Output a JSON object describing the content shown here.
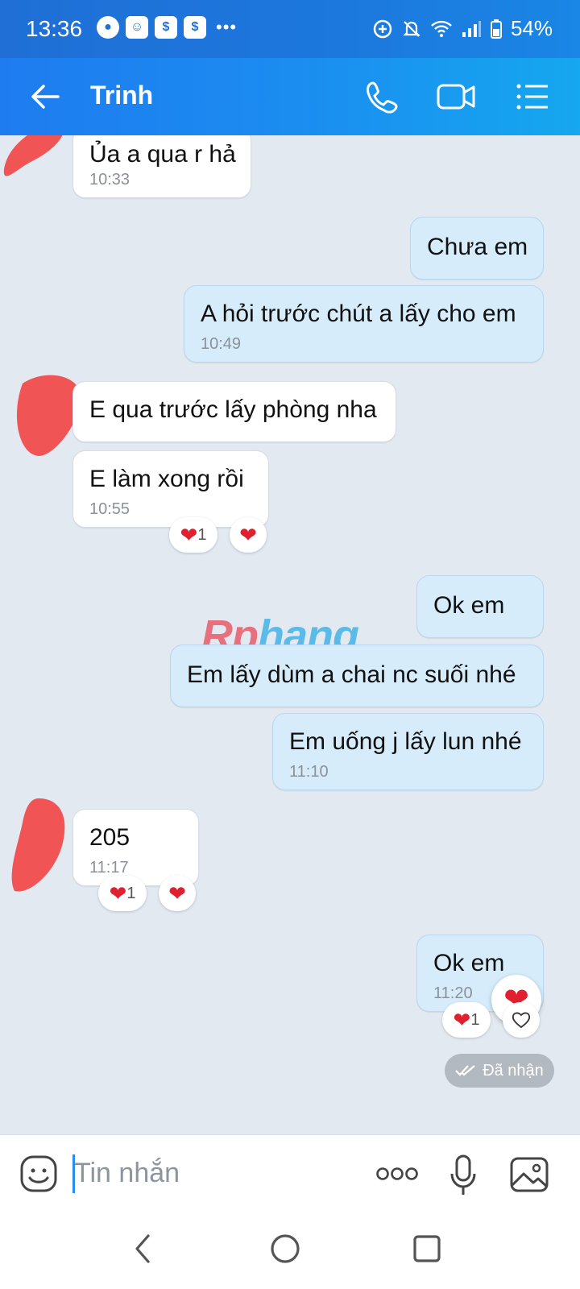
{
  "status_bar": {
    "time": "13:36",
    "battery": "54%",
    "notif_icons": [
      "messenger-icon",
      "app-icon",
      "dollar-shield-icon",
      "dollar-shield-icon"
    ],
    "more": "•••"
  },
  "header": {
    "contact_name": "Trinh",
    "icons": [
      "back-arrow-icon",
      "phone-icon",
      "video-call-icon",
      "menu-list-icon"
    ]
  },
  "messages": [
    {
      "side": "in",
      "text": "Ủa a qua r hả",
      "time": "10:33"
    },
    {
      "side": "out",
      "text": "Chưa em",
      "time": ""
    },
    {
      "side": "out",
      "text": "A hỏi trước chút a lấy cho em",
      "time": "10:49"
    },
    {
      "side": "in",
      "text": "E qua trước lấy phòng nha",
      "time": ""
    },
    {
      "side": "in",
      "text": "E làm xong rồi",
      "time": "10:55",
      "reaction_count": "1"
    },
    {
      "side": "out",
      "text": "Ok em",
      "time": ""
    },
    {
      "side": "out",
      "text": "Em lấy dùm a chai nc suối nhé",
      "time": ""
    },
    {
      "side": "out",
      "text": "Em uống j lấy lun nhé",
      "time": "11:10"
    },
    {
      "side": "in",
      "text": "205",
      "time": "11:17",
      "reaction_count": "1"
    },
    {
      "side": "out",
      "text": "Ok em",
      "time": "11:20",
      "reaction_count": "1"
    }
  ],
  "watermark": {
    "part1": "Rp",
    "part2": "hang"
  },
  "delivery_status": "Đã nhận",
  "composer": {
    "placeholder": "Tin nhắn",
    "icons": [
      "sticker-icon",
      "more-dots-icon",
      "microphone-icon",
      "image-icon"
    ]
  },
  "nav": {
    "icons": [
      "back-nav-icon",
      "home-nav-icon",
      "recents-nav-icon"
    ]
  },
  "colors": {
    "accent": "#1e7cf0",
    "outgoing_bubble": "#d6ecfb",
    "background": "#e2e9f1",
    "heart": "#e0202f"
  }
}
